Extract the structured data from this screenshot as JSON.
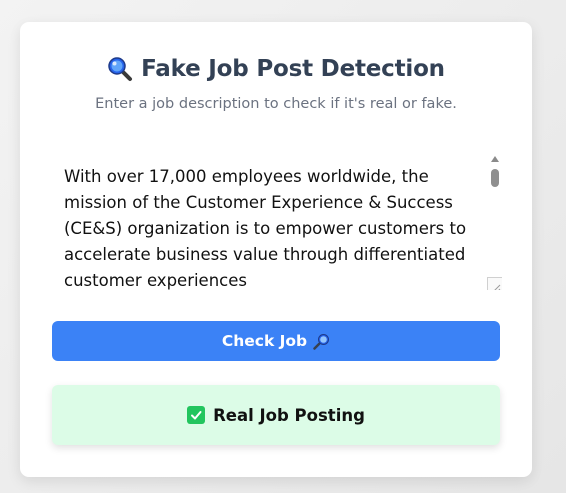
{
  "header": {
    "icon": "magnifier-icon",
    "title": "Fake Job Post Detection",
    "subtitle": "Enter a job description to check if it's real or fake."
  },
  "job_input": {
    "value": "With over 17,000 employees worldwide, the mission of the Customer Experience & Success (CE&S) organization is to empower customers to accelerate business value through differentiated customer experiences"
  },
  "check_button": {
    "label": "Check Job",
    "icon": "magnifier-icon"
  },
  "result": {
    "icon": "check-mark-icon",
    "text": "Real Job Posting"
  },
  "colors": {
    "accent": "#3b82f6",
    "success_bg": "#dcfce7",
    "success_icon": "#22c55e",
    "title": "#334155"
  }
}
